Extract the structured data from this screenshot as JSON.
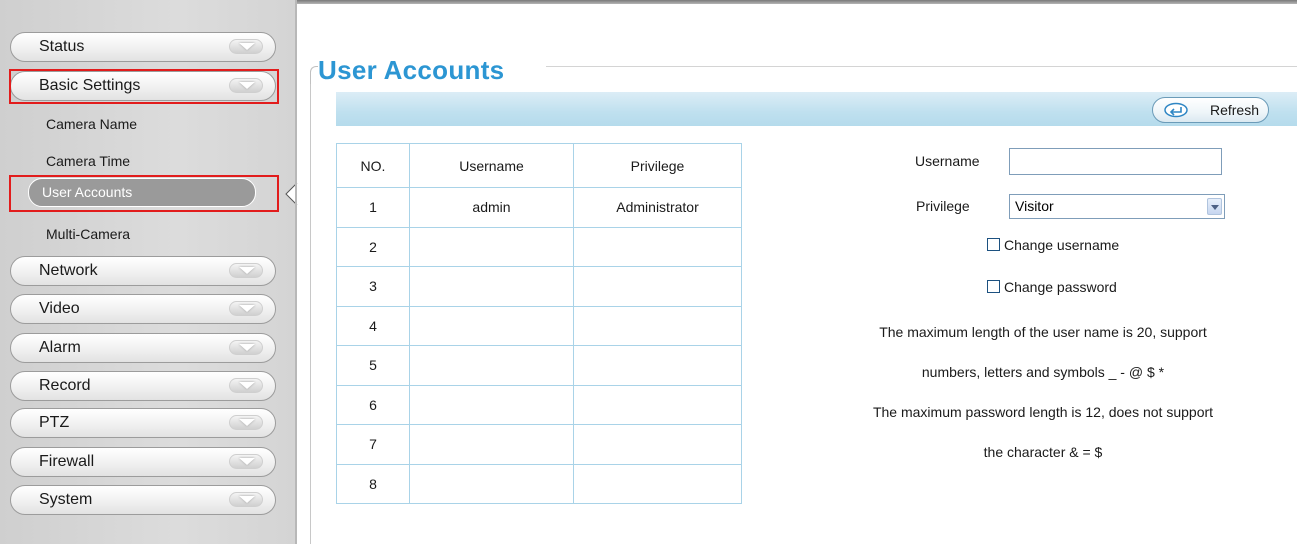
{
  "sidebar": {
    "menu": [
      "Status",
      "Basic Settings",
      "Network",
      "Video",
      "Alarm",
      "Record",
      "PTZ",
      "Firewall",
      "System"
    ],
    "submenu": [
      "Camera Name",
      "Camera Time",
      "User Accounts",
      "Multi-Camera"
    ]
  },
  "page": {
    "title": "User Accounts",
    "refresh_label": "Refresh"
  },
  "table": {
    "headers": [
      "NO.",
      "Username",
      "Privilege"
    ],
    "rows": [
      [
        "1",
        "admin",
        "Administrator"
      ],
      [
        "2",
        "",
        ""
      ],
      [
        "3",
        "",
        ""
      ],
      [
        "4",
        "",
        ""
      ],
      [
        "5",
        "",
        ""
      ],
      [
        "6",
        "",
        ""
      ],
      [
        "7",
        "",
        ""
      ],
      [
        "8",
        "",
        ""
      ]
    ]
  },
  "form": {
    "username_label": "Username",
    "username_value": "",
    "privilege_label": "Privilege",
    "privilege_value": "Visitor",
    "change_username_label": "Change username",
    "change_password_label": "Change password",
    "notes": [
      "The maximum length of the user name is 20, support",
      "numbers, letters and symbols _ - @ $ *",
      "The maximum password length is 12, does not support",
      "the character & = $"
    ]
  },
  "colors": {
    "title": "#2c96d3",
    "highlight_border": "#e21c1c",
    "table_border": "#a9d3e8",
    "toolbar": "#bfe0ef"
  }
}
